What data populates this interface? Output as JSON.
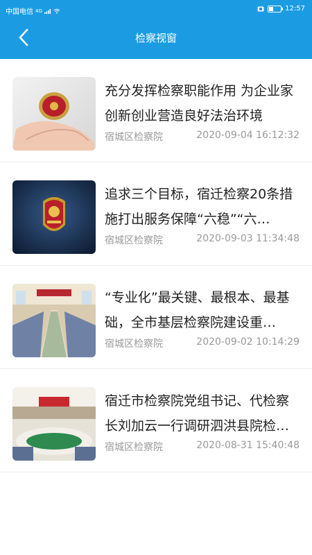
{
  "statusbar": {
    "carrier": "中国电信",
    "network": "4G",
    "time": "12:57",
    "battery_level": 0.35
  },
  "header": {
    "title": "检察视窗",
    "back_icon": "chevron-left-icon",
    "background_color": "#1b9ce2"
  },
  "articles": [
    {
      "title": "充分发挥检察职能作用 为企业家创新创业营造良好法治环境",
      "source": "宿城区检察院",
      "datetime": "2020-09-04 16:12:32",
      "thumbnail": "hand-holding-badge-photo"
    },
    {
      "title": "追求三个目标，宿迁检察20条措施打出服务保障“六稳”“六…",
      "source": "宿城区检察院",
      "datetime": "2020-09-03 11:34:48",
      "thumbnail": "procuratorate-emblem-photo"
    },
    {
      "title": "“专业化”最关键、最根本、最基础，全市基层检察院建设重…",
      "source": "宿城区检察院",
      "datetime": "2020-09-02 10:14:29",
      "thumbnail": "meeting-room-photo"
    },
    {
      "title": "宿迁市检察院党组书记、代检察长刘加云一行调研泗洪县院检…",
      "source": "宿城区检察院",
      "datetime": "2020-08-31 15:40:48",
      "thumbnail": "conference-table-photo"
    }
  ]
}
